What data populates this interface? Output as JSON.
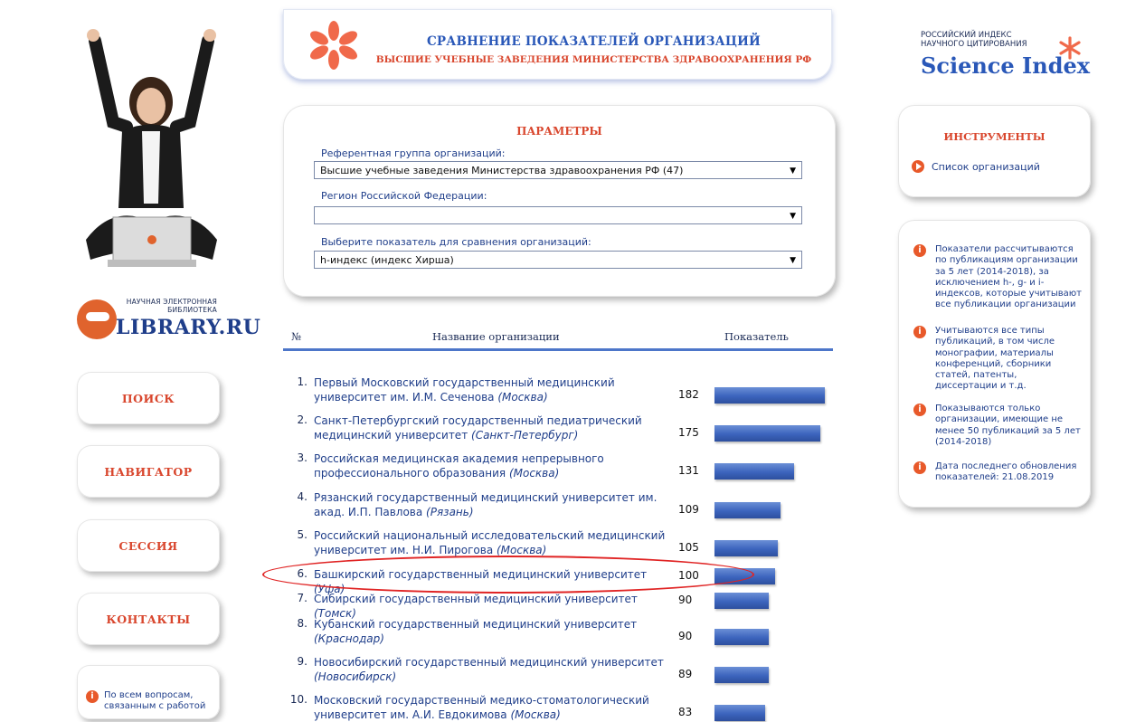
{
  "left": {
    "logo_sub": "НАУЧНАЯ ЭЛЕКТРОННАЯ БИБЛИОТЕКА",
    "logo_main": "LIBRARY.RU",
    "nav": [
      "ПОИСК",
      "НАВИГАТОР",
      "СЕССИЯ",
      "КОНТАКТЫ"
    ],
    "help_text": "По всем вопросам, связанным с работой"
  },
  "banner": {
    "title": "СРАВНЕНИЕ ПОКАЗАТЕЛЕЙ ОРГАНИЗАЦИЙ",
    "subtitle": "ВЫСШИЕ УЧЕБНЫЕ ЗАВЕДЕНИЯ МИНИСТЕРСТВА ЗДРАВООХРАНЕНИЯ РФ"
  },
  "params": {
    "title": "ПАРАМЕТРЫ",
    "group_label": "Референтная группа организаций:",
    "group_value": "Высшие учебные заведения Министерства здравоохранения РФ (47)",
    "region_label": "Регион Российской Федерации:",
    "region_value": "",
    "indicator_label": "Выберите показатель для сравнения организаций:",
    "indicator_value": "h-индекс (индекс Хирша)"
  },
  "table": {
    "col_num": "№",
    "col_name": "Название организации",
    "col_value": "Показатель",
    "rows": [
      {
        "num": "1.",
        "name": "Первый Московский государственный медицинский университет им. И.М. Сеченова",
        "city": "(Москва)",
        "value": 182
      },
      {
        "num": "2.",
        "name": "Санкт-Петербургский государственный педиатрический медицинский университет",
        "city": "(Санкт-Петербург)",
        "value": 175
      },
      {
        "num": "3.",
        "name": "Российская медицинская академия непрерывного профессионального образования",
        "city": "(Москва)",
        "value": 131
      },
      {
        "num": "4.",
        "name": "Рязанский государственный медицинский университет им. акад. И.П. Павлова",
        "city": "(Рязань)",
        "value": 109
      },
      {
        "num": "5.",
        "name": "Российский национальный исследовательский медицинский университет им. Н.И. Пирогова",
        "city": "(Москва)",
        "value": 105
      },
      {
        "num": "6.",
        "name": "Башкирский государственный медицинский университет",
        "city": "(Уфа)",
        "value": 100
      },
      {
        "num": "7.",
        "name": "Сибирский государственный медицинский университет",
        "city": "(Томск)",
        "value": 90
      },
      {
        "num": "8.",
        "name": "Кубанский государственный медицинский университет",
        "city": "(Краснодар)",
        "value": 90
      },
      {
        "num": "9.",
        "name": "Новосибирский государственный медицинский университет",
        "city": "(Новосибирск)",
        "value": 89
      },
      {
        "num": "10.",
        "name": "Московский государственный медико-стоматологический университет им. А.И. Евдокимова",
        "city": "(Москва)",
        "value": 83
      }
    ]
  },
  "right": {
    "si_small": "РОССИЙСКИЙ ИНДЕКС НАУЧНОГО ЦИТИРОВАНИЯ",
    "si_main": "Science Index",
    "tools_title": "ИНСТРУМЕНТЫ",
    "tools_link": "Список организаций",
    "notes": [
      "Показатели рассчитываются по публикациям организации за 5 лет (2014-2018), за исключением h-, g- и i-индексов, которые учитывают все публикации организации",
      "Учитываются все типы публикаций, в том числе монографии, материалы конференций, сборники статей, патенты, диссертации и т.д.",
      "Показываются только организации, имеющие не менее 50 публикаций за 5 лет (2014-2018)",
      "Дата последнего обновления показателей: 21.08.2019"
    ]
  },
  "colors": {
    "accent_red": "#d9472e",
    "accent_blue": "#2a58b8",
    "bar_blue": "#3c64bd",
    "highlight": "#e02424"
  }
}
